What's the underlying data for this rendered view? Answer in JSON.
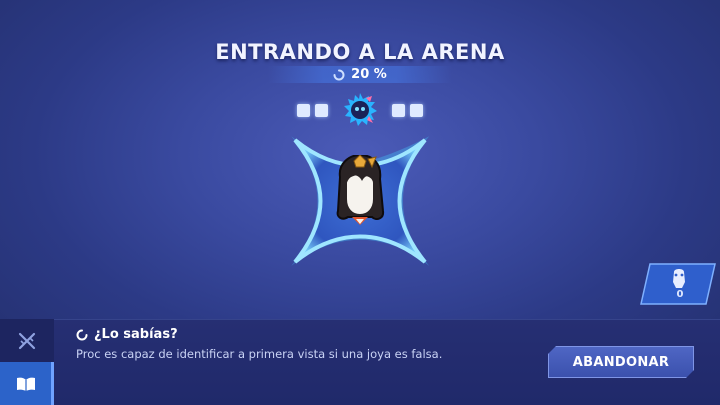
{
  "screen": {
    "title": "ENTRANDO A LA ARENA",
    "progress_text": "20 %",
    "progress_value": 0.2
  },
  "team_slots": {
    "left_count": 2,
    "right_count": 2,
    "center": "spiky-mascot-icon"
  },
  "counter": {
    "icon": "character-silhouette-icon",
    "value": "0"
  },
  "tip": {
    "heading": "¿Lo sabías?",
    "text": "Proc es capaz de identificar a primera vista si una joya es falsa."
  },
  "side_tabs": [
    {
      "icon": "crossed-swords-icon",
      "active": false
    },
    {
      "icon": "book-icon",
      "active": true
    }
  ],
  "actions": {
    "abandon_label": "ABANDONAR"
  },
  "colors": {
    "background": "#3a4aa0",
    "star_glow": "#45c8ff",
    "bottom_bar": "#232c6e",
    "active_tab": "#2c63c9"
  }
}
